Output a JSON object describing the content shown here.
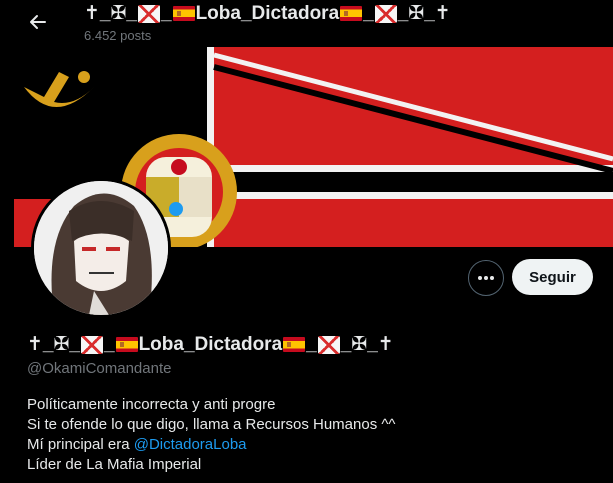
{
  "header": {
    "name_prefix": "✝_✠_",
    "name_mid": "_",
    "name_main": "Loba_Dictadora",
    "name_after": "_",
    "name_suffix": "_✠_✝",
    "posts": "6.452 posts"
  },
  "profile": {
    "name_prefix": "✝_✠_",
    "name_mid": "_",
    "name_main": "Loba_Dictadora",
    "name_after": "_",
    "name_suffix": "_✠_✝",
    "handle": "@OkamiComandante",
    "follow_label": "Seguir",
    "bio": {
      "line1": "Políticamente incorrecta y anti progre",
      "line2": "Si te ofende lo que digo, llama a Recursos Humanos ^^",
      "line3_prefix": "Mí principal era ",
      "line3_link": "@DictadoraLoba",
      "line4": "Líder de La Mafia Imperial"
    }
  },
  "colors": {
    "background": "#000000",
    "banner_red": "#d41f1f",
    "banner_gold": "#d8a01c",
    "link": "#1d9bf0",
    "muted": "#71767b"
  },
  "icons": [
    "back-arrow-icon",
    "more-options-icon",
    "spain-flag-icon",
    "saltire-flag-icon"
  ]
}
